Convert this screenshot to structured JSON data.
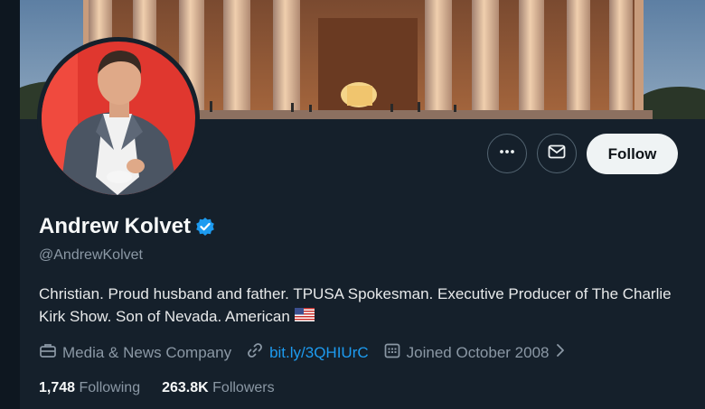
{
  "profile": {
    "name": "Andrew Kolvet",
    "handle": "@AndrewKolvet",
    "bio": "Christian. Proud husband and father. TPUSA Spokesman. Executive Producer of The Charlie Kirk Show. Son of Nevada. American",
    "bio_flag_icon": "us-flag-emoji",
    "verified_icon": "verified-badge-icon",
    "category": "Media & News Company",
    "website": "bit.ly/3QHIUrC",
    "joined": "Joined October 2008"
  },
  "actions": {
    "more_icon": "more-icon",
    "message_icon": "envelope-icon",
    "follow_label": "Follow"
  },
  "stats": {
    "following_count": "1,748",
    "following_label": "Following",
    "followers_count": "263.8K",
    "followers_label": "Followers"
  },
  "colors": {
    "background": "#15202b",
    "accent": "#1d9bf0",
    "follow_button_bg": "#eff3f4",
    "secondary_text": "#8b98a5"
  }
}
